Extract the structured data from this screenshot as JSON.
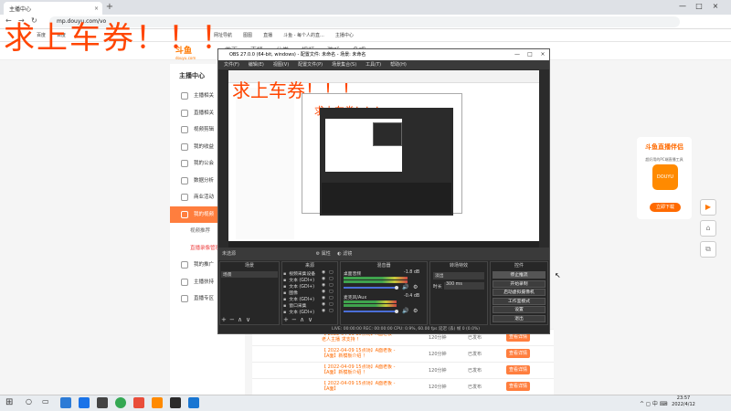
{
  "browser": {
    "tab_title": "主播中心",
    "tab_close": "×",
    "new_tab": "+",
    "url": "mp.douyu.com/vo",
    "win_min": "—",
    "win_max": "□",
    "win_close": "×",
    "bookmarks": [
      "百度",
      "百度",
      "网址导航",
      "图图",
      "直播",
      "斗鱼 - 每个人的直...",
      "主播中心"
    ]
  },
  "overlay_text": "求上车券！！！",
  "site": {
    "logo": "斗鱼",
    "logo_sub": "douyu.com",
    "nav": [
      "首页",
      "直播",
      "分类",
      "视频",
      "游戏",
      "鱼吧"
    ],
    "sidebar_title": "主播中心",
    "sidebar_items": [
      {
        "label": "主播相关",
        "style": "normal"
      },
      {
        "label": "直播相关",
        "style": "normal"
      },
      {
        "label": "视频剪辑",
        "style": "normal"
      },
      {
        "label": "我的收益",
        "style": "normal"
      },
      {
        "label": "我的公会",
        "style": "normal"
      },
      {
        "label": "数据分析",
        "style": "normal"
      },
      {
        "label": "商业活动",
        "style": "normal"
      },
      {
        "label": "我的视频",
        "style": "active"
      },
      {
        "label": "视频推荐",
        "style": "sub"
      },
      {
        "label": "直播录像管理",
        "style": "subred"
      },
      {
        "label": "我的推广",
        "style": "normal"
      },
      {
        "label": "主播扶持",
        "style": "normal"
      },
      {
        "label": "直播专区",
        "style": "normal"
      }
    ],
    "table_rows": [
      {
        "title": "【 2022-04-11 15点场】A面老板 - 老人主播 求支持 ！",
        "dur": "120分钟",
        "status": "已发布",
        "btn": "查看详情"
      },
      {
        "title": "【 2022-04-09 15点场】A面老板 - 【A面】新模板介绍 ！",
        "dur": "120分钟",
        "status": "已发布",
        "btn": "查看详情"
      },
      {
        "title": "【 2022-04-09 15点场】A面老板 - 【A面】新模板介绍 ！",
        "dur": "120分钟",
        "status": "已发布",
        "btn": "查看详情"
      },
      {
        "title": "【 2022-04-09 15点场】A面老板 - 【A面】",
        "dur": "120分钟",
        "status": "已发布",
        "btn": "查看详情"
      }
    ],
    "ad_title": "斗鱼直播伴侣",
    "ad_sub": "超好用的PC端直播工具",
    "ad_icon": "DOUYU",
    "ad_button": "立即下载"
  },
  "obs": {
    "title": "OBS 27.0.0 (64-bit, windows) - 配置文件: 未命名 - 场景: 未命名",
    "menu": [
      "文件(F)",
      "编辑(E)",
      "视图(V)",
      "配置文件(P)",
      "场景集合(S)",
      "工具(T)",
      "帮助(H)"
    ],
    "mid_label": "未选源",
    "mid_props": "属性",
    "mid_filters": "滤镜",
    "scenes_title": "场景",
    "scene_item": "场景",
    "sources_title": "来源",
    "sources": [
      "视频采集设备",
      "文本 (GDI+)",
      "文本 (GDI+)",
      "图像",
      "文本 (GDI+)",
      "窗口采集",
      "文本 (GDI+)"
    ],
    "mixer_title": "混音器",
    "mixer_channels": [
      {
        "name": "桌面音频",
        "db": "-1.8 dB"
      },
      {
        "name": "麦克风/Aux",
        "db": "-0.4 dB"
      }
    ],
    "trans_title": "转场特效",
    "trans_value": "淡出",
    "trans_duration_label": "时长",
    "trans_duration": "300 ms",
    "controls_title": "控件",
    "controls": [
      "停止推流",
      "开始录制",
      "启动虚拟摄像机",
      "工作室模式",
      "设置",
      "退出"
    ],
    "status": "LIVE: 00:00:00    REC: 00:00:00    CPU: 0.9%, 60.00 fps    延迟 (丢) 帧 0 (0.0%)"
  },
  "taskbar": {
    "time": "23:57",
    "date": "2022/4/12",
    "tray": "^ ◻ 中 ⌨"
  }
}
